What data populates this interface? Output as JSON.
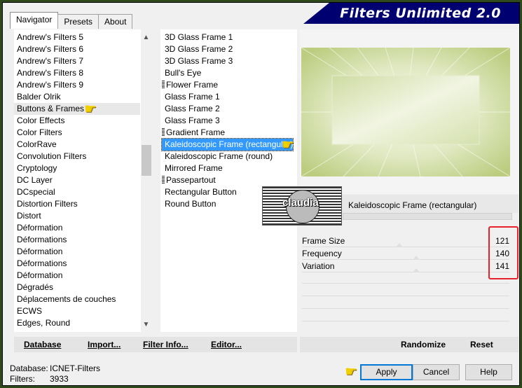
{
  "app": {
    "title": "Filters Unlimited 2.0"
  },
  "tabs": [
    {
      "label": "Navigator",
      "active": true
    },
    {
      "label": "Presets",
      "active": false
    },
    {
      "label": "About",
      "active": false
    }
  ],
  "categories": {
    "items": [
      "Andrew's Filters 5",
      "Andrew's Filters 6",
      "Andrew's Filters 7",
      "Andrew's Filters 8",
      "Andrew's Filters 9",
      "Balder Olrik",
      "Buttons & Frames",
      "Color Effects",
      "Color Filters",
      "ColorRave",
      "Convolution Filters",
      "Cryptology",
      "DC Layer",
      "DCspecial",
      "Distortion Filters",
      "Distort",
      "Déformation",
      "Déformations",
      "Déformation",
      "Déformations",
      "Déformation",
      "Dégradés",
      "Déplacements de couches",
      "ECWS",
      "Edges, Round"
    ],
    "selected": "Buttons & Frames"
  },
  "filters": {
    "items": [
      {
        "label": "3D Glass Frame 1",
        "marker": false
      },
      {
        "label": "3D Glass Frame 2",
        "marker": false
      },
      {
        "label": "3D Glass Frame 3",
        "marker": false
      },
      {
        "label": "Bull's Eye",
        "marker": false
      },
      {
        "label": "Flower Frame",
        "marker": true
      },
      {
        "label": "Glass Frame 1",
        "marker": false
      },
      {
        "label": "Glass Frame 2",
        "marker": false
      },
      {
        "label": "Glass Frame 3",
        "marker": false
      },
      {
        "label": "Gradient Frame",
        "marker": true
      },
      {
        "label": "Kaleidoscopic Frame (rectangular)",
        "marker": false
      },
      {
        "label": "Kaleidoscopic Frame (round)",
        "marker": false
      },
      {
        "label": "Mirrored Frame",
        "marker": false
      },
      {
        "label": "Passepartout",
        "marker": true
      },
      {
        "label": "Rectangular Button",
        "marker": false
      },
      {
        "label": "Round Button",
        "marker": false
      }
    ],
    "selected": "Kaleidoscopic Frame (rectangular)"
  },
  "preview": {
    "filter_name": "Kaleidoscopic Frame (rectangular)",
    "watermark": "claudia"
  },
  "params": [
    {
      "label": "Frame Size",
      "value": "121",
      "level": 0.47
    },
    {
      "label": "Frequency",
      "value": "140",
      "level": 0.55
    },
    {
      "label": "Variation",
      "value": "141",
      "level": 0.55
    }
  ],
  "actions": {
    "database": "Database",
    "import": "Import...",
    "filter_info": "Filter Info...",
    "editor": "Editor...",
    "randomize": "Randomize",
    "reset": "Reset"
  },
  "status": {
    "database_label": "Database:",
    "database_value": "ICNET-Filters",
    "filters_label": "Filters:",
    "filters_value": "3933"
  },
  "buttons": {
    "apply": "Apply",
    "cancel": "Cancel",
    "help": "Help"
  },
  "colors": {
    "banner": "#000070",
    "selection": "#3399ff",
    "accent_red": "#e8222b",
    "preview_tint": "#c5d68f"
  }
}
